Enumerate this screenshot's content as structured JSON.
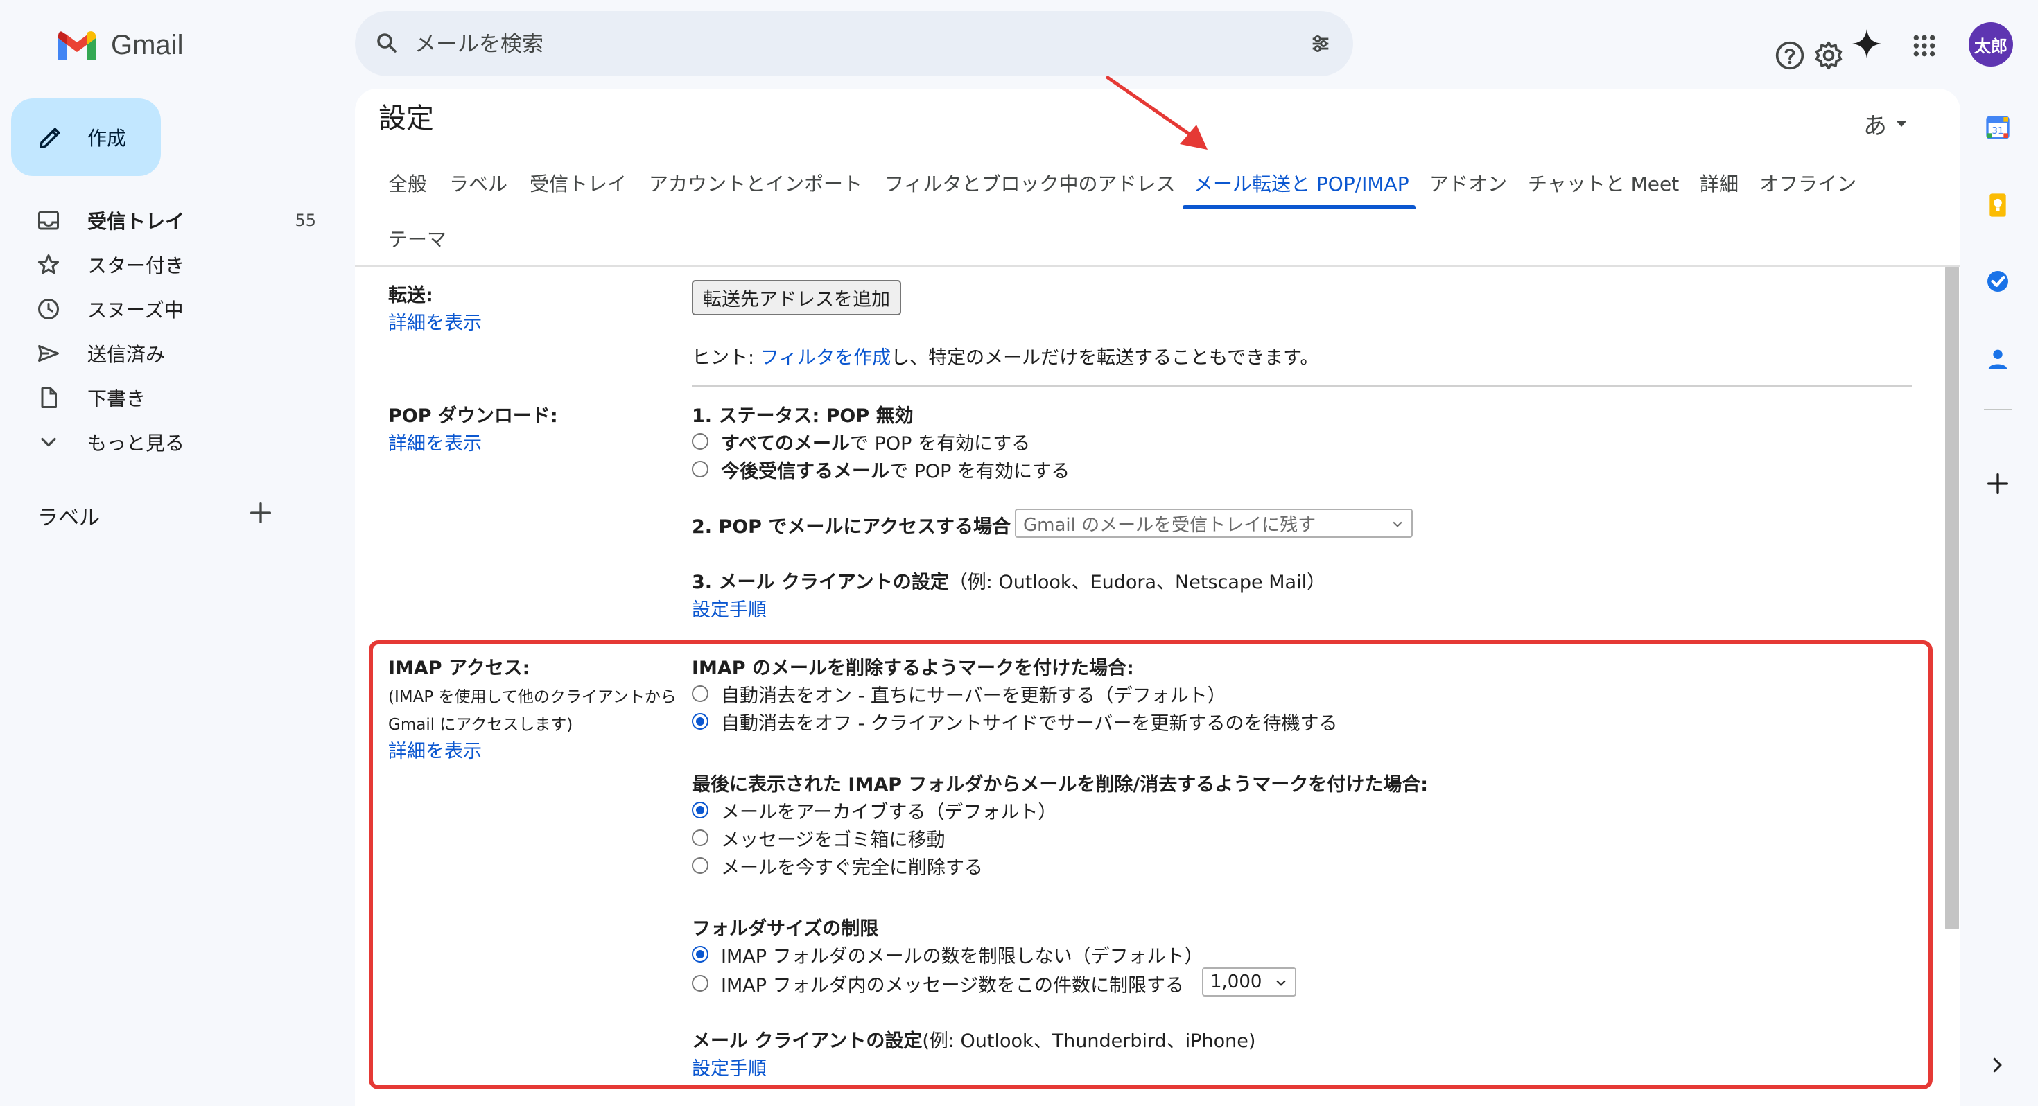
{
  "app": {
    "brand": "Gmail"
  },
  "search": {
    "placeholder": "メールを検索"
  },
  "user": {
    "avatar_text": "太郎"
  },
  "compose": {
    "label": "作成"
  },
  "sidebar": {
    "items": [
      {
        "label": "受信トレイ",
        "count": "55",
        "icon": "inbox-icon"
      },
      {
        "label": "スター付き",
        "icon": "star-icon"
      },
      {
        "label": "スヌーズ中",
        "icon": "clock-icon"
      },
      {
        "label": "送信済み",
        "icon": "send-icon"
      },
      {
        "label": "下書き",
        "icon": "draft-icon"
      },
      {
        "label": "もっと見る",
        "icon": "chevron-down-icon"
      }
    ],
    "labels_heading": "ラベル"
  },
  "settings": {
    "title": "設定",
    "input_tool": "あ",
    "tabs": [
      "全般",
      "ラベル",
      "受信トレイ",
      "アカウントとインポート",
      "フィルタとブロック中のアドレス",
      "メール転送と POP/IMAP",
      "アドオン",
      "チャットと Meet",
      "詳細",
      "オフライン",
      "テーマ"
    ],
    "active_tab": "メール転送と POP/IMAP",
    "learn_more": "詳細を表示",
    "forwarding": {
      "label": "転送:",
      "add_button": "転送先アドレスを追加",
      "hint_prefix": "ヒント: ",
      "hint_link": "フィルタを作成",
      "hint_suffix": "し、特定のメールだけを転送することもできます。"
    },
    "pop": {
      "label": "POP ダウンロード:",
      "status": "1. ステータス: POP 無効",
      "opt1_bold": "すべてのメール",
      "opt1_rest": "で POP を有効にする",
      "opt2_bold": "今後受信するメール",
      "opt2_rest": "で POP を有効にする",
      "access_label": "2. POP でメールにアクセスする場合",
      "access_select": "Gmail のメールを受信トレイに残す",
      "client_bold": "3. メール クライアントの設定",
      "client_rest": "（例: Outlook、Eudora、Netscape Mail）",
      "setup_link": "設定手順"
    },
    "imap": {
      "label": "IMAP アクセス:",
      "desc1": "(IMAP を使用して他のクライアントから",
      "desc2": "Gmail にアクセスします)",
      "expunge_heading": "IMAP のメールを削除するようマークを付けた場合:",
      "expunge_on": "自動消去をオン - 直ちにサーバーを更新する（デフォルト）",
      "expunge_off": "自動消去をオフ - クライアントサイドでサーバーを更新するのを待機する",
      "delete_heading": "最後に表示された IMAP フォルダからメールを削除/消去するようマークを付けた場合:",
      "delete_archive": "メールをアーカイブする（デフォルト）",
      "delete_trash": "メッセージをゴミ箱に移動",
      "delete_forever": "メールを今すぐ完全に削除する",
      "folder_heading": "フォルダサイズの制限",
      "folder_nolimit": "IMAP フォルダのメールの数を制限しない（デフォルト）",
      "folder_limit": "IMAP フォルダ内のメッセージ数をこの件数に制限する",
      "folder_limit_value": "1,000",
      "client_bold": "メール クライアントの設定",
      "client_rest": "(例: Outlook、Thunderbird、iPhone)",
      "setup_link": "設定手順"
    }
  },
  "colors": {
    "accent": "#0b57d0",
    "highlight": "#e53935",
    "compose_bg": "#c2e7ff",
    "avatar_bg": "#5e35b1"
  }
}
